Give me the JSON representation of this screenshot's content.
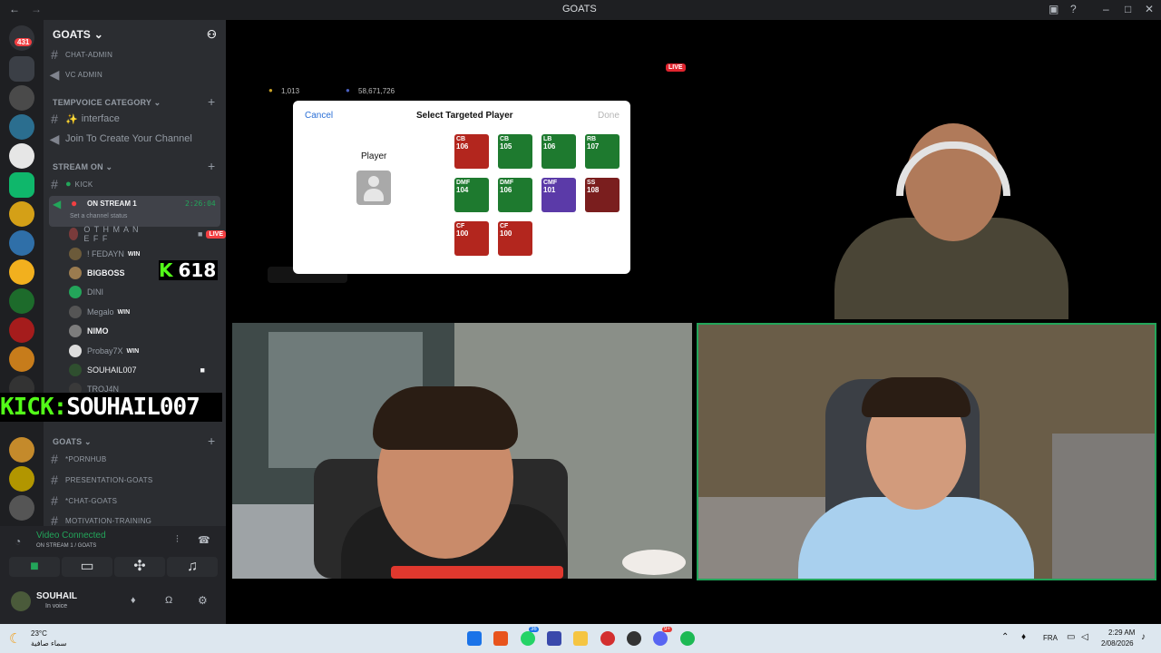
{
  "window": {
    "title": "GOATS"
  },
  "server_badge": "431",
  "server": {
    "name": "GOATS"
  },
  "channels": {
    "top": [
      "CHAT-ADMIN",
      "VC ADMIN"
    ],
    "tempvoice_category": "TEMPVOICE CATEGORY",
    "interface": "interface",
    "join_create": "Join To Create Your Channel",
    "stream_on_category": "STREAM ON",
    "kick": "KICK",
    "on_stream": "ON STREAM 1",
    "on_stream_time": "2:26:04",
    "channel_status": "Set a channel status",
    "goats_category": "GOATS",
    "goats_channels": [
      "*PORNHUB",
      "PRESENTATION-GOATS",
      "*CHAT-GOATS",
      "MOTIVATION-TRAINING"
    ]
  },
  "users": [
    {
      "name": "O T H M A N E F F",
      "live": "LIVE"
    },
    {
      "name": "! FEDAYN",
      "badge": "WIN"
    },
    {
      "name": "BIGBOSS"
    },
    {
      "name": "DINI"
    },
    {
      "name": "Megalo",
      "badge": "WIN"
    },
    {
      "name": "NIMO"
    },
    {
      "name": "Probay7X",
      "badge": "WIN"
    },
    {
      "name": "SOUHAIL007"
    },
    {
      "name": "TROJ4N"
    }
  ],
  "overlay": {
    "kick_count": "618",
    "kick_prefix": "KICK:",
    "kick_name": "SOUHAIL007"
  },
  "voice": {
    "status": "Video Connected",
    "channel": "ON STREAM 1 / GOATS",
    "user_name": "SOUHAIL",
    "user_status": "In voice"
  },
  "game": {
    "live": "LIVE",
    "coins": "1,013",
    "points": "58,671,726",
    "dialog": {
      "cancel": "Cancel",
      "title": "Select Targeted Player",
      "done": "Done",
      "player_label": "Player"
    },
    "cards": [
      {
        "pos": "CB",
        "rating": "106",
        "color": "#b3261e"
      },
      {
        "pos": "CB",
        "rating": "105",
        "color": "#1e7a2f"
      },
      {
        "pos": "LB",
        "rating": "106",
        "color": "#1e7a2f"
      },
      {
        "pos": "RB",
        "rating": "107",
        "color": "#1e7a2f"
      },
      {
        "pos": "DMF",
        "rating": "104",
        "color": "#1e7a2f"
      },
      {
        "pos": "DMF",
        "rating": "106",
        "color": "#1e7a2f"
      },
      {
        "pos": "CMF",
        "rating": "101",
        "color": "#5b3aa8"
      },
      {
        "pos": "SS",
        "rating": "108",
        "color": "#7a1e1e"
      },
      {
        "pos": "CF",
        "rating": "100",
        "color": "#b3261e"
      },
      {
        "pos": "CF",
        "rating": "100",
        "color": "#b3261e"
      }
    ]
  },
  "taskbar": {
    "temp": "23°C",
    "weather": "سماء صافية",
    "lang": "FRA",
    "time": "2:29 AM",
    "date": "2/08/2026",
    "badge_whatsapp": "36",
    "badge_discord": "9+"
  }
}
